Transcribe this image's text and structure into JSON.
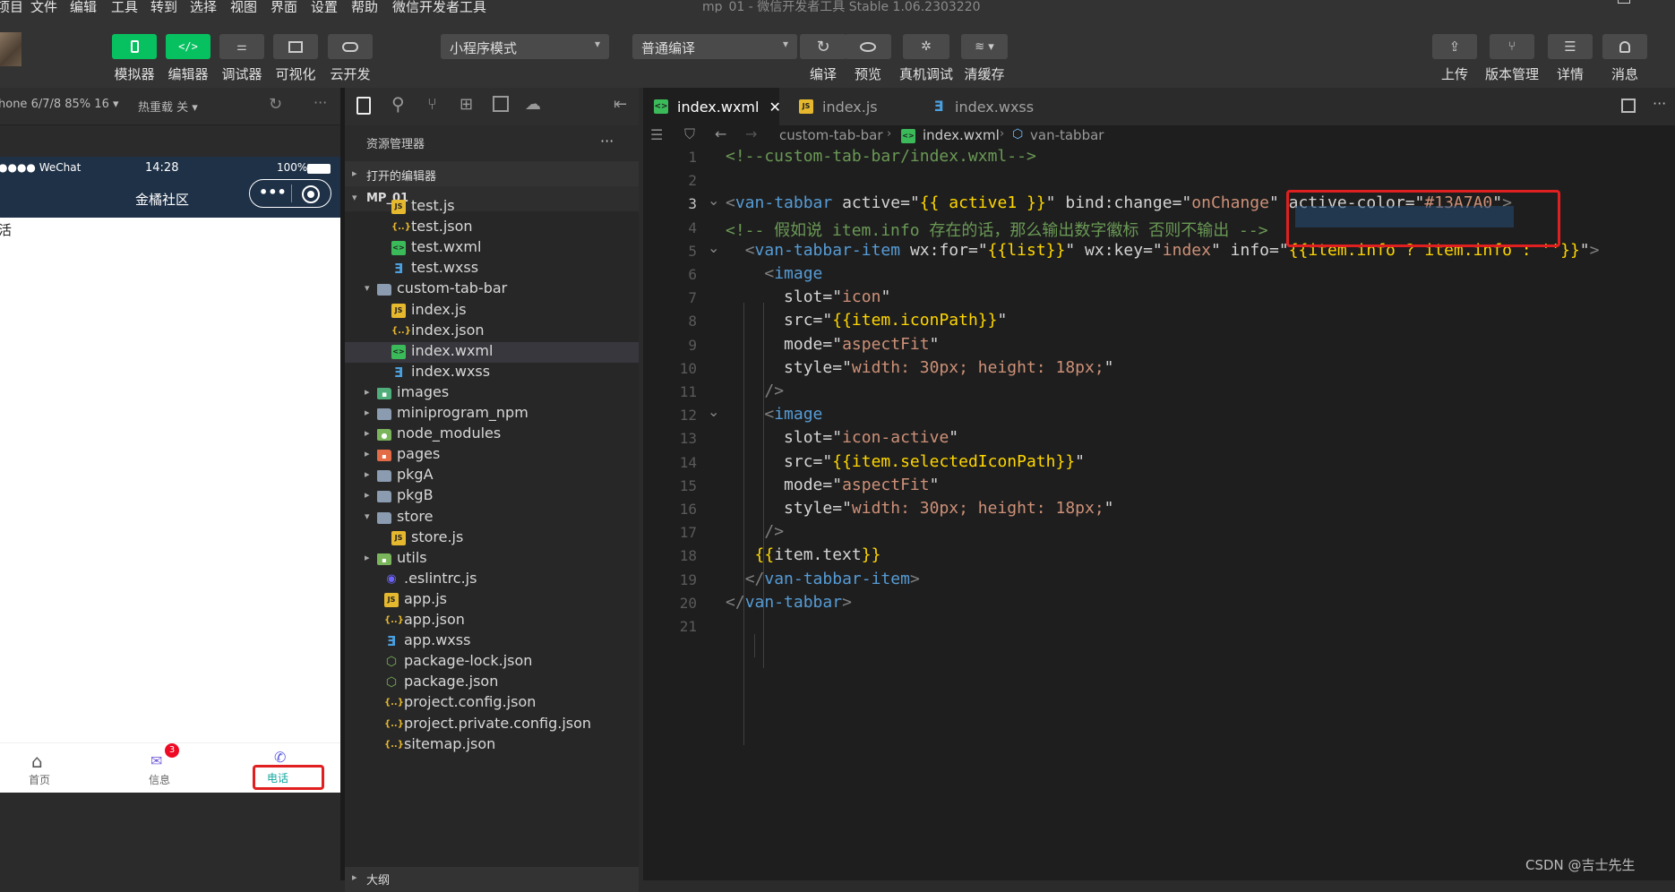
{
  "menu": [
    "项目",
    "文件",
    "编辑",
    "工具",
    "转到",
    "选择",
    "视图",
    "界面",
    "设置",
    "帮助",
    "微信开发者工具"
  ],
  "window_title": "mp_01 - 微信开发者工具 Stable 1.06.2303220",
  "toolbar": {
    "left_buttons": [
      "模拟器",
      "编辑器",
      "调试器",
      "可视化",
      "云开发"
    ],
    "mode_select": "小程序模式",
    "compile_select": "普通编译",
    "mid_buttons": [
      "编译",
      "预览",
      "真机调试",
      "清缓存"
    ],
    "right_buttons": [
      "上传",
      "版本管理",
      "详情",
      "消息"
    ]
  },
  "simulator": {
    "device": "hone 6/7/8 85% 16 ▾",
    "hot_reload": "热重载 关 ▾",
    "carrier": "●●●● WeChat",
    "time": "14:28",
    "battery": "100%",
    "nav_title": "金橘社区",
    "page_text": "活",
    "tabs": [
      {
        "label": "首页",
        "badge": ""
      },
      {
        "label": "信息",
        "badge": "3"
      },
      {
        "label": "电话",
        "badge": ""
      }
    ],
    "active_color": "#13A7A0"
  },
  "explorer": {
    "title": "资源管理器",
    "more": "···",
    "open_editors": "打开的编辑器",
    "project": "MP_01",
    "items": [
      {
        "name": "test.js",
        "type": "js",
        "depth": 2
      },
      {
        "name": "test.json",
        "type": "json",
        "depth": 2
      },
      {
        "name": "test.wxml",
        "type": "wxml",
        "depth": 2
      },
      {
        "name": "test.wxss",
        "type": "wxss",
        "depth": 2
      },
      {
        "name": "custom-tab-bar",
        "type": "folder-open",
        "depth": 1
      },
      {
        "name": "index.js",
        "type": "js",
        "depth": 2
      },
      {
        "name": "index.json",
        "type": "json",
        "depth": 2
      },
      {
        "name": "index.wxml",
        "type": "wxml",
        "depth": 2,
        "selected": true
      },
      {
        "name": "index.wxss",
        "type": "wxss",
        "depth": 2
      },
      {
        "name": "images",
        "type": "folder-img",
        "depth": 1
      },
      {
        "name": "miniprogram_npm",
        "type": "folder",
        "depth": 1
      },
      {
        "name": "node_modules",
        "type": "folder-node",
        "depth": 1
      },
      {
        "name": "pages",
        "type": "folder-pages",
        "depth": 1
      },
      {
        "name": "pkgA",
        "type": "folder",
        "depth": 1
      },
      {
        "name": "pkgB",
        "type": "folder",
        "depth": 1
      },
      {
        "name": "store",
        "type": "folder-open",
        "depth": 1
      },
      {
        "name": "store.js",
        "type": "js",
        "depth": 2
      },
      {
        "name": "utils",
        "type": "folder-utils",
        "depth": 1
      },
      {
        "name": ".eslintrc.js",
        "type": "eslint",
        "depth": 1
      },
      {
        "name": "app.js",
        "type": "js",
        "depth": 1
      },
      {
        "name": "app.json",
        "type": "json",
        "depth": 1
      },
      {
        "name": "app.wxss",
        "type": "wxss",
        "depth": 1
      },
      {
        "name": "package-lock.json",
        "type": "npm",
        "depth": 1
      },
      {
        "name": "package.json",
        "type": "npm",
        "depth": 1
      },
      {
        "name": "project.config.json",
        "type": "json",
        "depth": 1
      },
      {
        "name": "project.private.config.json",
        "type": "json",
        "depth": 1
      },
      {
        "name": "sitemap.json",
        "type": "json",
        "depth": 1
      }
    ],
    "outline": "大纲"
  },
  "editor": {
    "tabs": [
      "index.wxml",
      "index.js",
      "index.wxss"
    ],
    "breadcrumb": [
      "custom-tab-bar",
      "index.wxml",
      "van-tabbar"
    ],
    "lines": [
      "<!--custom-tab-bar/index.wxml-->",
      "",
      "<van-tabbar active=\"{{ active1 }}\" bind:change=\"onChange\" active-color=\"#13A7A0\">",
      "<!-- 假如说 item.info 存在的话，那么输出数字徽标 否则不输出 -->",
      "  <van-tabbar-item wx:for=\"{{list}}\" wx:key=\"index\" info=\"{{item.info ? item.info : ''}}\">",
      "    <image",
      "      slot=\"icon\"",
      "      src=\"{{item.iconPath}}\"",
      "      mode=\"aspectFit\"",
      "      style=\"width: 30px; height: 18px;\"",
      "    />",
      "    <image",
      "      slot=\"icon-active\"",
      "      src=\"{{item.selectedIconPath}}\"",
      "      mode=\"aspectFit\"",
      "      style=\"width: 30px; height: 18px;\"",
      "    />",
      "   {{item.text}}",
      "  </van-tabbar-item>",
      "</van-tabbar>",
      ""
    ]
  },
  "watermark": "CSDN @吉士先生",
  "colors": {
    "accent_green": "#07c160",
    "highlight_red": "#e02020"
  }
}
